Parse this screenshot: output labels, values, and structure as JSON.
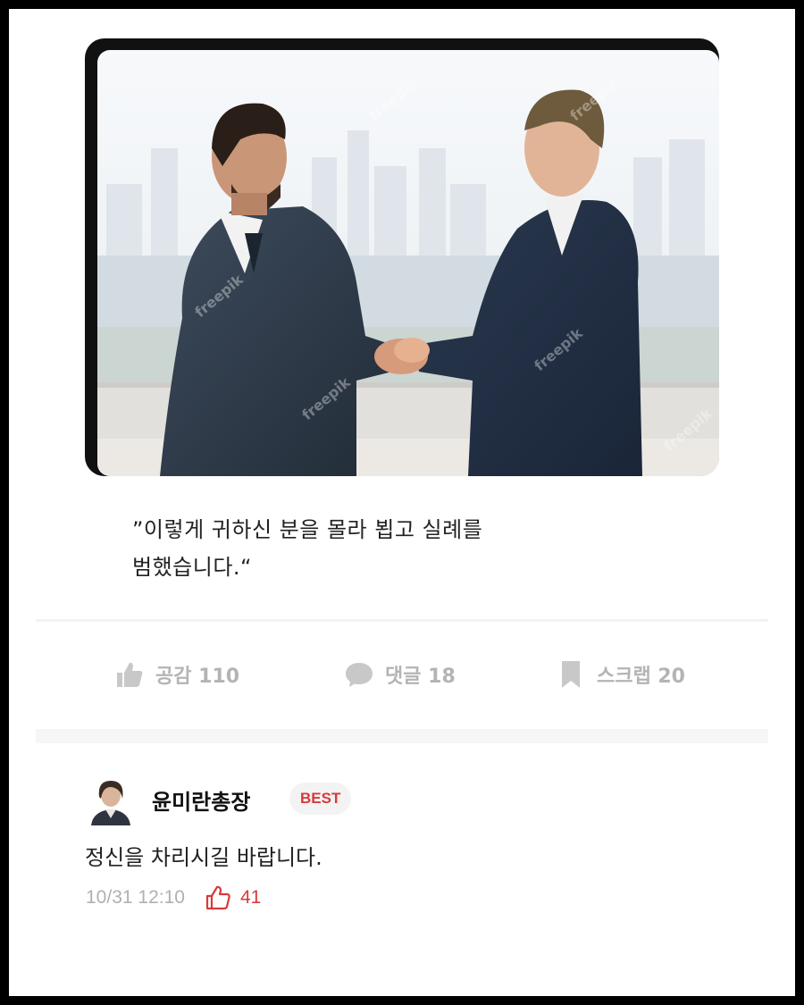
{
  "post": {
    "image": {
      "description_icon": "handshake-photo",
      "watermark": "freepik"
    },
    "quote_line1": "”이렇게 귀하신 분을 몰라 뵙고 실례를",
    "quote_line2": "범했습니다.“"
  },
  "actions": {
    "like_icon": "thumbs-up-icon",
    "like_label": "공감 110",
    "comment_icon": "speech-bubble-icon",
    "comment_label": "댓글 18",
    "scrap_icon": "bookmark-icon",
    "scrap_label": "스크랩 20"
  },
  "comment": {
    "author": "윤미란총장",
    "badge": "BEST",
    "text": "정신을 차리시길 바랍니다.",
    "timestamp": "10/31 12:10",
    "like_count": "41"
  },
  "colors": {
    "accent_red": "#d83a3a",
    "icon_gray": "#b4b4b4"
  }
}
